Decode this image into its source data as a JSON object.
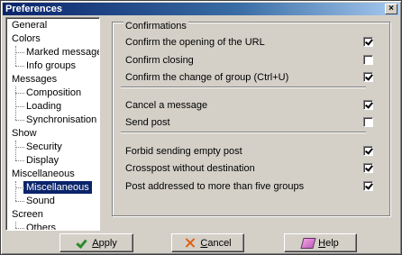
{
  "window": {
    "title": "Preferences",
    "close_label": "×"
  },
  "tree": {
    "items": [
      {
        "label": "General",
        "level": 0,
        "selected": false
      },
      {
        "label": "Colors",
        "level": 0,
        "selected": false
      },
      {
        "label": "Marked messages",
        "level": 1,
        "selected": false
      },
      {
        "label": "Info groups",
        "level": 1,
        "selected": false
      },
      {
        "label": "Messages",
        "level": 0,
        "selected": false
      },
      {
        "label": "Composition",
        "level": 1,
        "selected": false
      },
      {
        "label": "Loading",
        "level": 1,
        "selected": false
      },
      {
        "label": "Synchronisation",
        "level": 1,
        "selected": false
      },
      {
        "label": "Show",
        "level": 0,
        "selected": false
      },
      {
        "label": "Security",
        "level": 1,
        "selected": false
      },
      {
        "label": "Display",
        "level": 1,
        "selected": false
      },
      {
        "label": "Miscellaneous",
        "level": 0,
        "selected": false
      },
      {
        "label": "Miscellaneous",
        "level": 1,
        "selected": true
      },
      {
        "label": "Sound",
        "level": 1,
        "selected": false
      },
      {
        "label": "Screen",
        "level": 0,
        "selected": false
      },
      {
        "label": "Others",
        "level": 1,
        "selected": false
      }
    ]
  },
  "confirmations": {
    "title": "Confirmations",
    "options": [
      {
        "label": "Confirm the opening of the URL",
        "checked": true
      },
      {
        "label": "Confirm closing",
        "checked": false
      },
      {
        "label": "Confirm the change of group (Ctrl+U)",
        "checked": true
      },
      {
        "label": "Cancel a message",
        "checked": true
      },
      {
        "label": "Send post",
        "checked": false
      },
      {
        "label": "Forbid sending empty post",
        "checked": true
      },
      {
        "label": "Crosspost without destination",
        "checked": true
      },
      {
        "label": "Post addressed to more than five groups",
        "checked": true
      }
    ]
  },
  "buttons": {
    "apply": {
      "mnemonic": "A",
      "rest": "pply",
      "icon": "check-icon"
    },
    "cancel": {
      "mnemonic": "C",
      "rest": "ancel",
      "icon": "cross-icon"
    },
    "help": {
      "mnemonic": "H",
      "rest": "elp",
      "icon": "eraser-icon"
    }
  }
}
